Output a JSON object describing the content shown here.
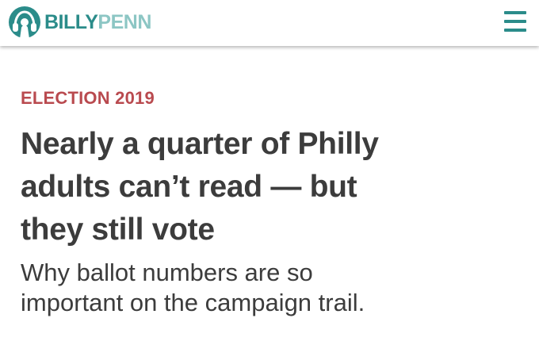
{
  "header": {
    "logo": {
      "part1": "BILLY",
      "part2": "PENN",
      "icon": "headphones-logo-icon"
    },
    "menu_icon": "hamburger-menu-icon"
  },
  "article": {
    "category": "ELECTION 2019",
    "headline_lines": [
      "Nearly a quarter of Philly",
      "adults can’t read — but",
      "they still vote"
    ],
    "subhead_lines": [
      "Why ballot numbers are so",
      "important on the campaign trail."
    ]
  },
  "colors": {
    "brand_teal": "#2b8c8a",
    "brand_light_teal": "#8cc6c4",
    "category_red": "#b94a4f",
    "text_dark": "#3c3c3c"
  }
}
